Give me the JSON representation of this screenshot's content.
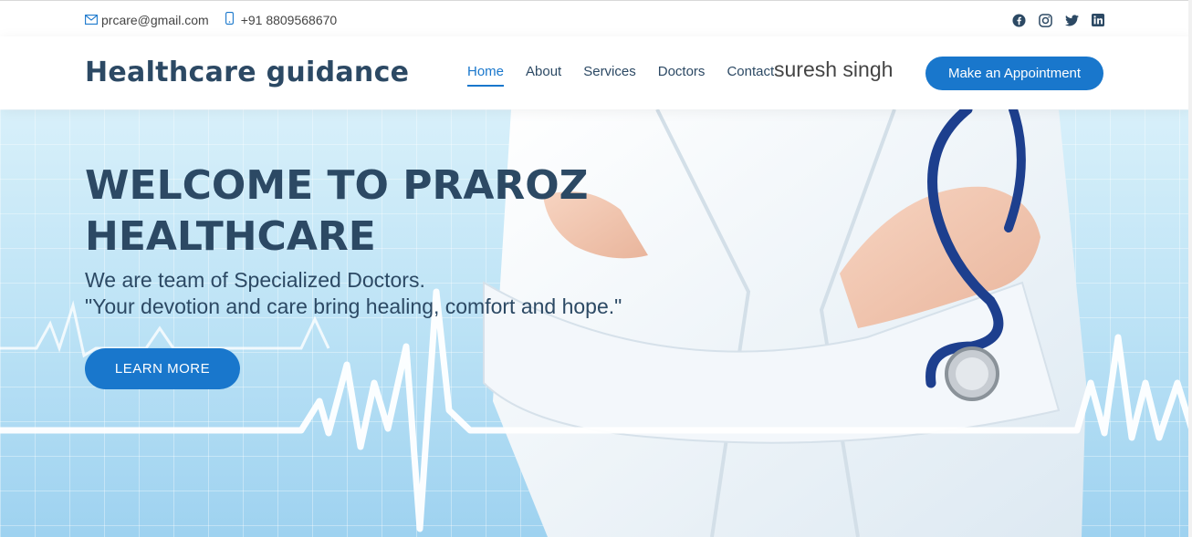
{
  "topbar": {
    "email": "prcare@gmail.com",
    "phone": "+91 8809568670",
    "email_icon": "envelope-icon",
    "phone_icon": "phone-icon",
    "social": [
      "facebook-icon",
      "instagram-icon",
      "twitter-icon",
      "linkedin-icon"
    ]
  },
  "header": {
    "logo": "Healthcare guidance",
    "nav": [
      {
        "label": "Home",
        "active": true
      },
      {
        "label": "About"
      },
      {
        "label": "Services"
      },
      {
        "label": "Doctors"
      },
      {
        "label": "Contact"
      }
    ],
    "user_name": "suresh singh",
    "appointment_label": "Make an Appointment"
  },
  "hero": {
    "title": "WELCOME TO PRAROZ HEALTHCARE",
    "subtitle_line1": "We are team of Specialized Doctors.",
    "subtitle_line2": "\"Your devotion and care bring healing, comfort and hope.\"",
    "cta_label": "LEARN MORE"
  },
  "colors": {
    "primary": "#1977cc",
    "heading": "#2c4964"
  }
}
